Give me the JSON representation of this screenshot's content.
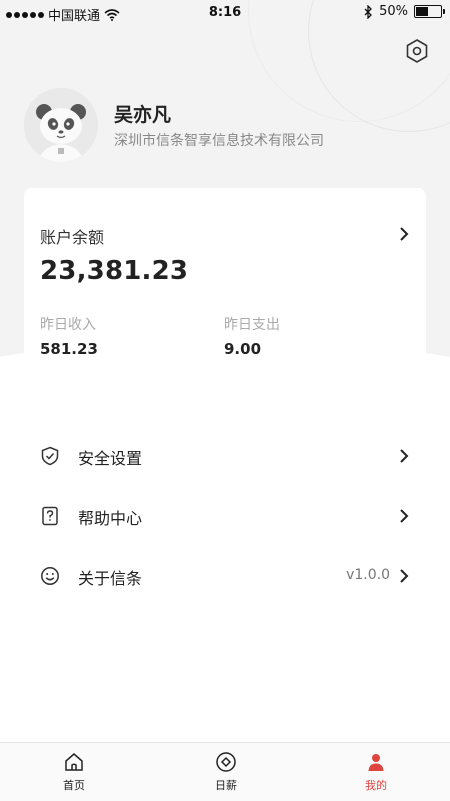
{
  "status_bar": {
    "carrier": "中国联通",
    "time": "8:16",
    "battery": "50%",
    "battery_level": 0.5,
    "icons": [
      "signal-dots-icon",
      "wifi-icon",
      "bluetooth-icon",
      "battery-icon"
    ]
  },
  "header": {
    "settings_icon": "hexagon-settings-icon"
  },
  "profile": {
    "name": "吴亦凡",
    "company": "深圳市信条智享信息技术有限公司",
    "avatar": "panda-avatar"
  },
  "account": {
    "balance_label": "账户余额",
    "balance_value": "23,381.23",
    "income_label": "昨日收入",
    "income_value": "581.23",
    "expense_label": "昨日支出",
    "expense_value": "9.00"
  },
  "menu": {
    "items": [
      {
        "label": "安全设置",
        "icon": "shield-check-icon",
        "value": ""
      },
      {
        "label": "帮助中心",
        "icon": "help-question-icon",
        "value": ""
      },
      {
        "label": "关于信条",
        "icon": "smiley-icon",
        "value": "v1.0.0"
      }
    ]
  },
  "tabs": {
    "items": [
      {
        "label": "首页",
        "icon": "home-icon"
      },
      {
        "label": "日薪",
        "icon": "daily-circle-icon"
      },
      {
        "label": "我的",
        "icon": "person-icon"
      }
    ],
    "active_color": "#e0443e"
  }
}
